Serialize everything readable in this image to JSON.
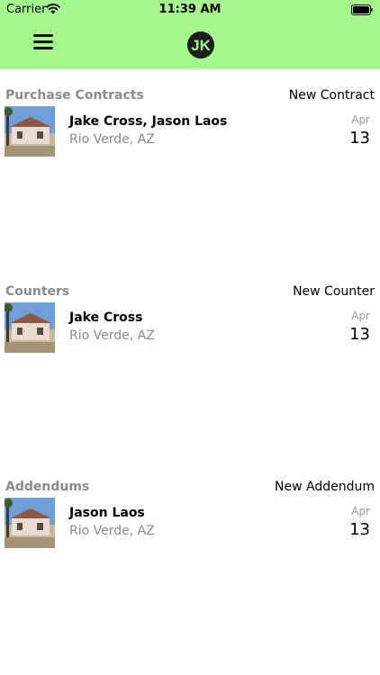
{
  "status_bar": {
    "carrier": "Carrier",
    "time": "11:39 AM",
    "wifi_icon": "wifi-icon",
    "battery_icon": "battery-icon"
  },
  "nav": {
    "menu_icon": "hamburger-menu-icon",
    "logo_text": "JK",
    "brand_color": "#a4f78c"
  },
  "sections": [
    {
      "title": "Purchase Contracts",
      "action": "New Contract",
      "rows": [
        {
          "names": "Jake Cross, Jason Laos",
          "location": "Rio Verde, AZ",
          "month": "Apr",
          "day": "13"
        }
      ]
    },
    {
      "title": "Counters",
      "action": "New Counter",
      "rows": [
        {
          "names": "Jake Cross",
          "location": "Rio Verde, AZ",
          "month": "Apr",
          "day": "13"
        }
      ]
    },
    {
      "title": "Addendums",
      "action": "New Addendum",
      "rows": [
        {
          "names": "Jason Laos",
          "location": "Rio Verde, AZ",
          "month": "Apr",
          "day": "13"
        }
      ]
    }
  ]
}
